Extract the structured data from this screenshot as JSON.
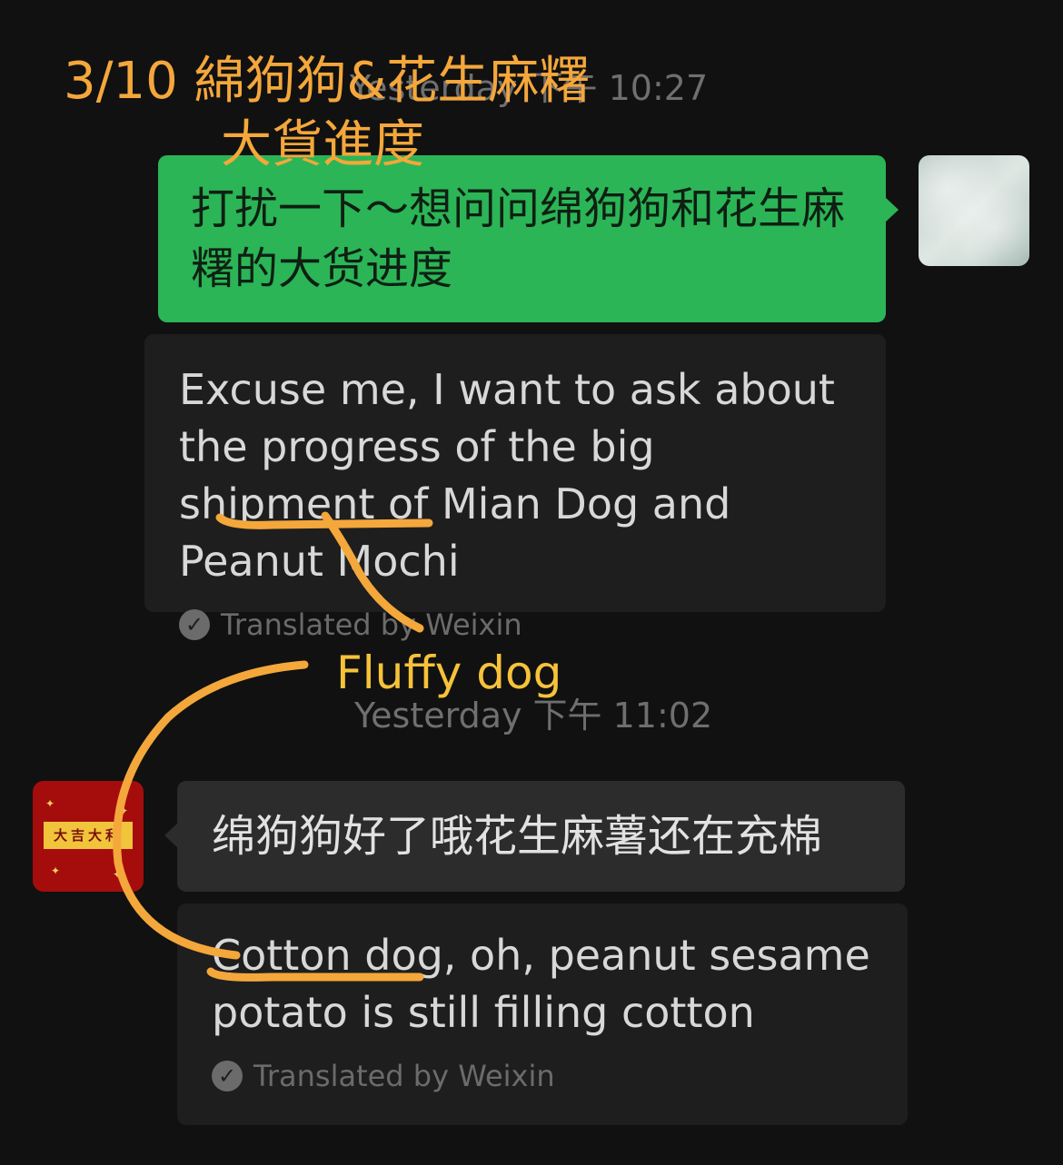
{
  "annotations": {
    "title_line1": "3/10 綿狗狗&花生麻糬",
    "title_line2": "大貨進度",
    "fluffy_dog": "Fluffy dog"
  },
  "chat": {
    "timestamp_1": "Yesterday 下午 10:27",
    "timestamp_2": "Yesterday 下午 11:02",
    "messages": [
      {
        "sender": "me",
        "text": "打扰一下～想问问绵狗狗和花生麻糬的大货进度",
        "translation": "Excuse me, I want to ask about the progress of the big shipment of Mian Dog and Peanut Mochi",
        "translation_label": "Translated by Weixin"
      },
      {
        "sender": "them",
        "text": "绵狗狗好了哦花生麻薯还在充棉",
        "translation": "Cotton dog, oh, peanut sesame potato is still filling cotton",
        "translation_label": "Translated by Weixin",
        "avatar_text": "大吉大利"
      }
    ]
  },
  "colors": {
    "background": "#111111",
    "sent_bubble": "#2bb556",
    "received_bubble": "#2c2c2c",
    "translation_bg": "#1e1e1e",
    "annotation": "#f4a73b"
  }
}
